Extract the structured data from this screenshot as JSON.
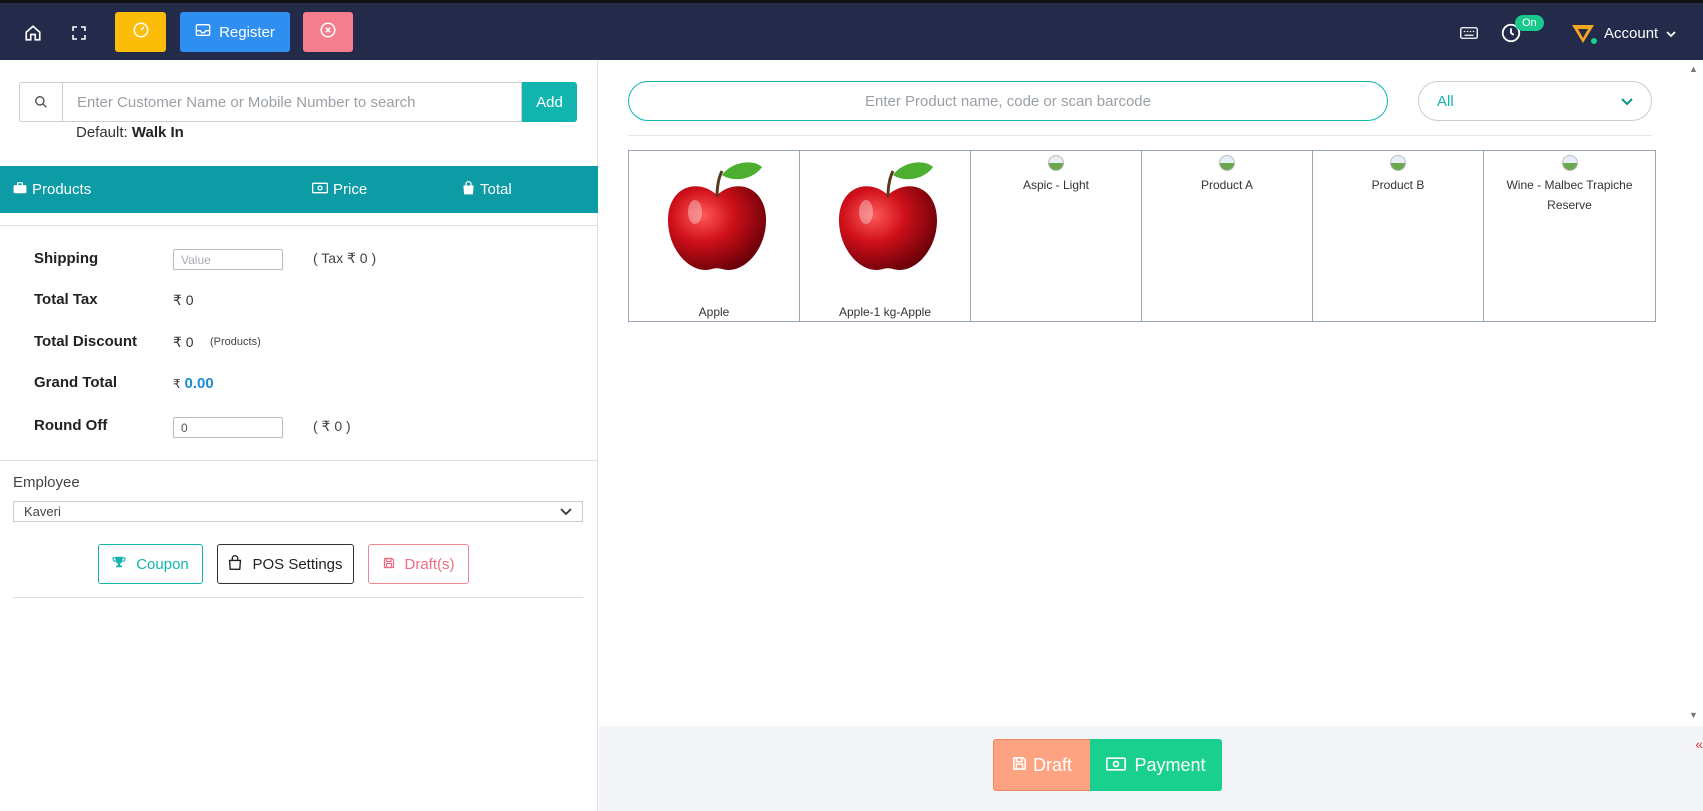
{
  "topbar": {
    "register_label": "Register",
    "status_badge": "On",
    "account_label": "Account"
  },
  "customer": {
    "search_placeholder": "Enter Customer Name or Mobile Number to search",
    "add_label": "Add",
    "default_prefix": "Default:",
    "default_value": "Walk In"
  },
  "cart_header": {
    "products": "Products",
    "price": "Price",
    "total": "Total"
  },
  "summary": {
    "shipping_label": "Shipping",
    "shipping_placeholder": "Value",
    "shipping_tax": "( Tax ₹ 0 )",
    "total_tax_label": "Total Tax",
    "total_tax_value": "₹ 0",
    "total_discount_label": "Total Discount",
    "total_discount_value": "₹ 0",
    "total_discount_note": "(Products)",
    "grand_total_label": "Grand Total",
    "grand_total_currency": "₹",
    "grand_total_value": "0.00",
    "round_off_label": "Round Off",
    "round_off_value": "0",
    "round_off_note": "( ₹ 0 )"
  },
  "employee": {
    "label": "Employee",
    "selected": "Kaveri"
  },
  "actions": {
    "coupon": "Coupon",
    "pos_settings": "POS Settings",
    "drafts": "Draft(s)"
  },
  "products_panel": {
    "search_placeholder": "Enter Product name, code or scan barcode",
    "category_selected": "All",
    "items": [
      {
        "name": "Apple",
        "image": "apple"
      },
      {
        "name": "Apple-1 kg-Apple",
        "image": "apple"
      },
      {
        "name": "Aspic - Light",
        "image": "placeholder"
      },
      {
        "name": "Product A",
        "image": "placeholder"
      },
      {
        "name": "Product B",
        "image": "placeholder"
      },
      {
        "name": "Wine - Malbec Trapiche Reserve",
        "image": "placeholder"
      }
    ]
  },
  "footer": {
    "draft_label": "Draft",
    "payment_label": "Payment"
  },
  "colors": {
    "topbar": "#232a4a",
    "teal": "#11b5ad",
    "header_teal": "#0d9ba6",
    "yellow": "#fbbd08",
    "blue": "#2f8ff0",
    "pink": "#f47d8e",
    "draft": "#fda381",
    "payment": "#19d08e"
  }
}
